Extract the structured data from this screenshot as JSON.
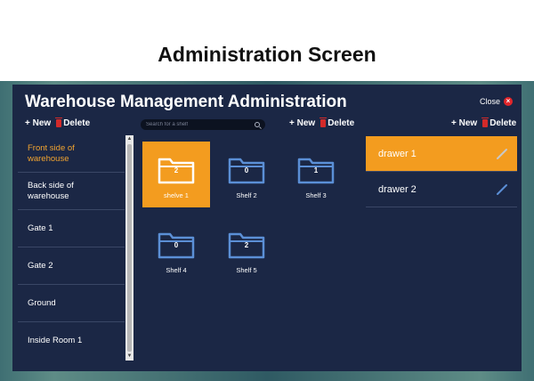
{
  "page_title": "Administration Screen",
  "window": {
    "title": "Warehouse Management Administration",
    "close_label": "Close"
  },
  "left_toolbar": {
    "new_label": "+ New",
    "delete_label": "Delete"
  },
  "middle_toolbar": {
    "new_label": "+ New",
    "delete_label": "Delete"
  },
  "right_toolbar": {
    "new_label": "+ New",
    "delete_label": "Delete"
  },
  "search": {
    "placeholder": "Search for a shelf"
  },
  "locations": [
    {
      "label": "Front side of warehouse",
      "active": true
    },
    {
      "label": "Back side of warehouse",
      "active": false
    },
    {
      "label": "Gate 1",
      "active": false
    },
    {
      "label": "Gate 2",
      "active": false
    },
    {
      "label": "Ground",
      "active": false
    },
    {
      "label": "Inside Room 1",
      "active": false
    }
  ],
  "shelves": [
    {
      "label": "shelve 1",
      "count": "2",
      "active": true
    },
    {
      "label": "Shelf 2",
      "count": "0",
      "active": false
    },
    {
      "label": "Shelf 3",
      "count": "1",
      "active": false
    },
    {
      "label": "Shelf 4",
      "count": "0",
      "active": false
    },
    {
      "label": "Shelf 5",
      "count": "2",
      "active": false
    }
  ],
  "drawers": [
    {
      "label": "drawer 1",
      "active": true
    },
    {
      "label": "drawer 2",
      "active": false
    }
  ],
  "colors": {
    "accent": "#f39c1f",
    "panel": "#1b2745",
    "folder": "#5b8fd6",
    "delete": "#d32a2a"
  },
  "icons": {
    "close": "close-icon",
    "delete": "trash-icon",
    "search": "search-icon",
    "folder": "folder-icon",
    "edit": "pencil-icon"
  }
}
